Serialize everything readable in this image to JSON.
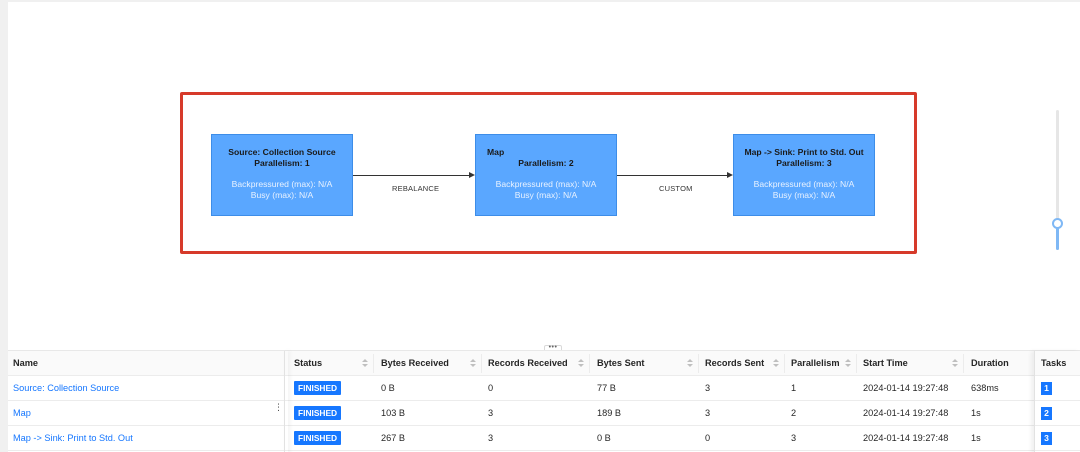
{
  "graph": {
    "nodes": [
      {
        "name": "Source: Collection Source",
        "parallelism": "Parallelism: 1",
        "backpressure": "Backpressured (max): N/A",
        "busy": "Busy (max): N/A"
      },
      {
        "name": "Map",
        "parallelism": "Parallelism: 2",
        "backpressure": "Backpressured (max): N/A",
        "busy": "Busy (max): N/A"
      },
      {
        "name": "Map -> Sink: Print to Std. Out",
        "parallelism": "Parallelism: 3",
        "backpressure": "Backpressured (max): N/A",
        "busy": "Busy (max): N/A"
      }
    ],
    "edges": [
      {
        "label": "REBALANCE"
      },
      {
        "label": "CUSTOM"
      }
    ],
    "highlight_color": "#d63a2a",
    "node_color": "#5aa7ff"
  },
  "resizer": {
    "label": "•••"
  },
  "table": {
    "headers": {
      "name": "Name",
      "status": "Status",
      "bytes_received": "Bytes Received",
      "records_received": "Records Received",
      "bytes_sent": "Bytes Sent",
      "records_sent": "Records Sent",
      "parallelism": "Parallelism",
      "start_time": "Start Time",
      "duration": "Duration",
      "tasks": "Tasks"
    },
    "rows": [
      {
        "name": "Source: Collection Source",
        "status": "FINISHED",
        "bytes_received": "0 B",
        "records_received": "0",
        "bytes_sent": "77 B",
        "records_sent": "3",
        "parallelism": "1",
        "start_time": "2024-01-14 19:27:48",
        "duration": "638ms",
        "tasks": "1"
      },
      {
        "name": "Map",
        "status": "FINISHED",
        "bytes_received": "103 B",
        "records_received": "3",
        "bytes_sent": "189 B",
        "records_sent": "3",
        "parallelism": "2",
        "start_time": "2024-01-14 19:27:48",
        "duration": "1s",
        "tasks": "2"
      },
      {
        "name": "Map -> Sink: Print to Std. Out",
        "status": "FINISHED",
        "bytes_received": "267 B",
        "records_received": "3",
        "bytes_sent": "0 B",
        "records_sent": "0",
        "parallelism": "3",
        "start_time": "2024-01-14 19:27:48",
        "duration": "1s",
        "tasks": "3"
      }
    ],
    "column_handle": "⋮"
  },
  "colors": {
    "accent": "#1677ff",
    "status_finished": "#1677ff"
  }
}
